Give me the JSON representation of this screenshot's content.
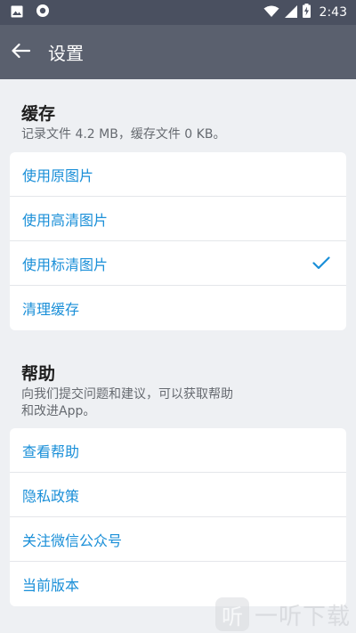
{
  "status_bar": {
    "time": "2:43",
    "icons": [
      "image-icon",
      "record-icon",
      "wifi-icon",
      "signal-icon",
      "battery-charging-icon"
    ]
  },
  "toolbar": {
    "back_icon": "arrow-left-icon",
    "title": "设置"
  },
  "cache": {
    "title": "缓存",
    "description": "记录文件 4.2 MB，缓存文件 0 KB。",
    "items": [
      {
        "label": "使用原图片",
        "checked": false
      },
      {
        "label": "使用高清图片",
        "checked": false
      },
      {
        "label": "使用标清图片",
        "checked": true
      },
      {
        "label": "清理缓存",
        "checked": false
      }
    ]
  },
  "help": {
    "title": "帮助",
    "description_line1": "向我们提交问题和建议，可以获取帮助",
    "description_line2": "和改进App。",
    "items": [
      {
        "label": "查看帮助"
      },
      {
        "label": "隐私政策"
      },
      {
        "label": "关注微信公众号"
      },
      {
        "label": "当前版本"
      }
    ]
  },
  "watermark": {
    "logo_char": "听",
    "text": "一听下载"
  },
  "colors": {
    "status_bar_bg": "#4a5060",
    "toolbar_bg": "#5a606e",
    "page_bg": "#eef0f3",
    "accent": "#1a8fd8"
  }
}
